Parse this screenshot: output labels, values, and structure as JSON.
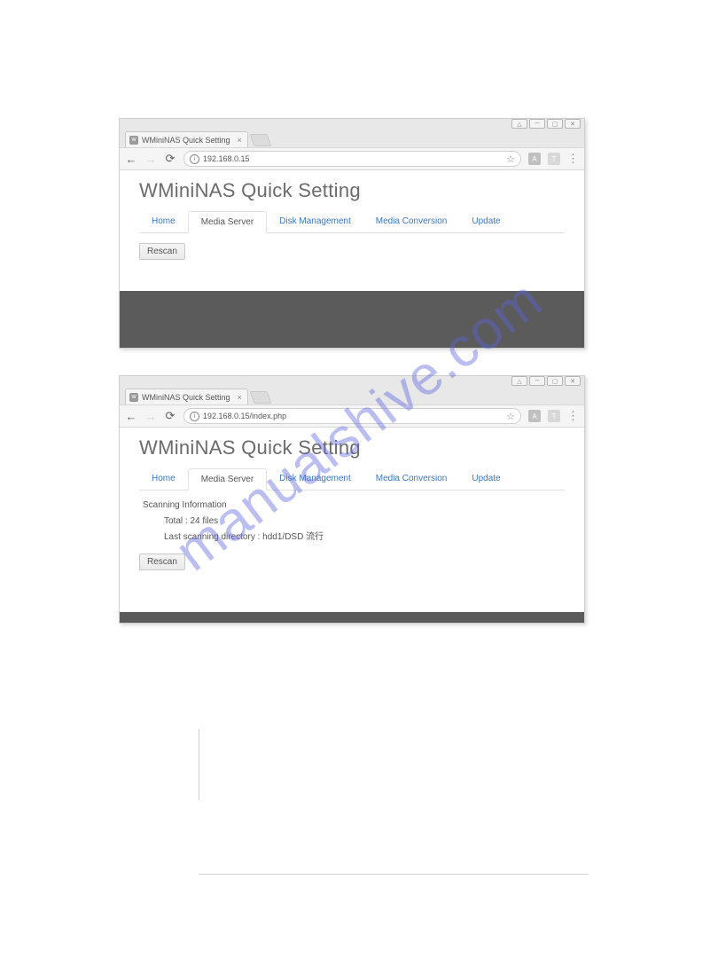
{
  "watermark": "manualshive.com",
  "window1": {
    "tab_title": "WMiniNAS Quick Setting",
    "url": "192.168.0.15",
    "page_title": "WMiniNAS Quick Setting",
    "tabs": {
      "home": "Home",
      "media_server": "Media Server",
      "disk_management": "Disk Management",
      "media_conversion": "Media Conversion",
      "update": "Update"
    },
    "rescan": "Rescan"
  },
  "window2": {
    "tab_title": "WMiniNAS Quick Setting",
    "url": "192.168.0.15/index.php",
    "page_title": "WMiniNAS Quick Setting",
    "tabs": {
      "home": "Home",
      "media_server": "Media Server",
      "disk_management": "Disk Management",
      "media_conversion": "Media Conversion",
      "update": "Update"
    },
    "scan_heading": "Scanning Information",
    "scan_total": "Total : 24 files",
    "scan_last": "Last scanning directory : hdd1/DSD 流行",
    "rescan": "Rescan"
  },
  "ext_labels": {
    "a": "A",
    "t": "T"
  }
}
